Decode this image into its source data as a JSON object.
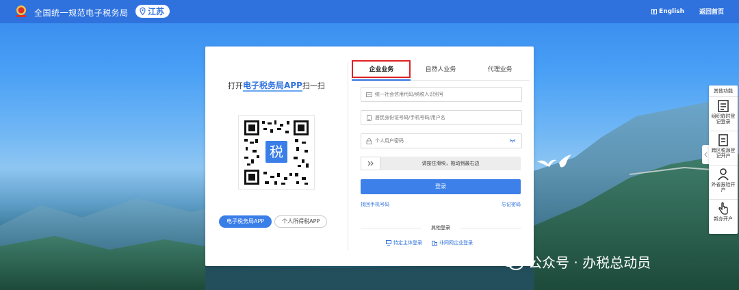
{
  "header": {
    "site_title": "全国统一规范电子税务局",
    "region": "江苏",
    "language": "English",
    "home_link": "返回首页",
    "logo_text": "国家税务总局"
  },
  "left_panel": {
    "scan_prefix": "打开",
    "scan_highlight": "电子税务局APP",
    "scan_suffix": "扫一扫",
    "qr_center_char": "税",
    "app_tabs": [
      "电子税务局APP",
      "个人所得税APP"
    ]
  },
  "login": {
    "tabs": [
      "企业业务",
      "自然人业务",
      "代理业务"
    ],
    "active_tab": 0,
    "credit_code_placeholder": "统一社会信用代码/纳税人识别号",
    "id_placeholder": "居民身份证号码/手机号码/用户名",
    "password_placeholder": "个人用户密码",
    "slider_text": "请按住滑块，拖动到最右边",
    "login_button": "登录",
    "find_phone": "找回手机号码",
    "forgot_password": "忘记密码",
    "other_login_title": "其他登录",
    "other_links": [
      "特定主体登录",
      "非同网企业登录"
    ]
  },
  "sidebar": {
    "title": "其他功能",
    "items": [
      {
        "label": "组织临时登记登录",
        "icon": "document-list-icon"
      },
      {
        "label": "跨区税源登记开户",
        "icon": "document-icon"
      },
      {
        "label": "外省报验开户",
        "icon": "person-icon"
      },
      {
        "label": "新办开户",
        "icon": "hand-pointer-icon"
      }
    ]
  },
  "watermark": "公众号 · 办税总动员",
  "colors": {
    "topbar": "#2f72de",
    "primary": "#3d80ea",
    "highlight_box": "#e02020"
  }
}
